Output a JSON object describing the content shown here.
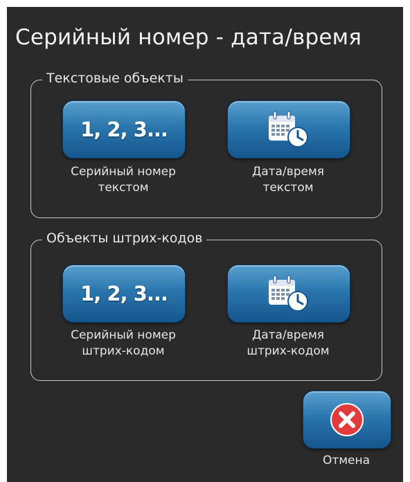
{
  "dialog": {
    "title": "Серийный номер - дата/время"
  },
  "text_objects": {
    "legend": "Текстовые объекты",
    "serial_button": {
      "icon_text": "1, 2, 3...",
      "caption_line1": "Серийный номер",
      "caption_line2": "текстом"
    },
    "datetime_button": {
      "icon": "calendar-clock-icon",
      "caption_line1": "Дата/время",
      "caption_line2": "текстом"
    }
  },
  "barcode_objects": {
    "legend": "Объекты штрих-кодов",
    "serial_button": {
      "icon_text": "1, 2, 3...",
      "caption_line1": "Серийный номер",
      "caption_line2": "штрих-кодом"
    },
    "datetime_button": {
      "icon": "calendar-clock-icon",
      "caption_line1": "Дата/время",
      "caption_line2": "штрих-кодом"
    }
  },
  "cancel": {
    "icon": "close-icon",
    "label": "Отмена"
  },
  "colors": {
    "background": "#2a2a2a",
    "button_top": "#5aa0cf",
    "button_bottom": "#15568e",
    "cancel_red": "#e23b3b",
    "text": "#f2f2f2"
  }
}
